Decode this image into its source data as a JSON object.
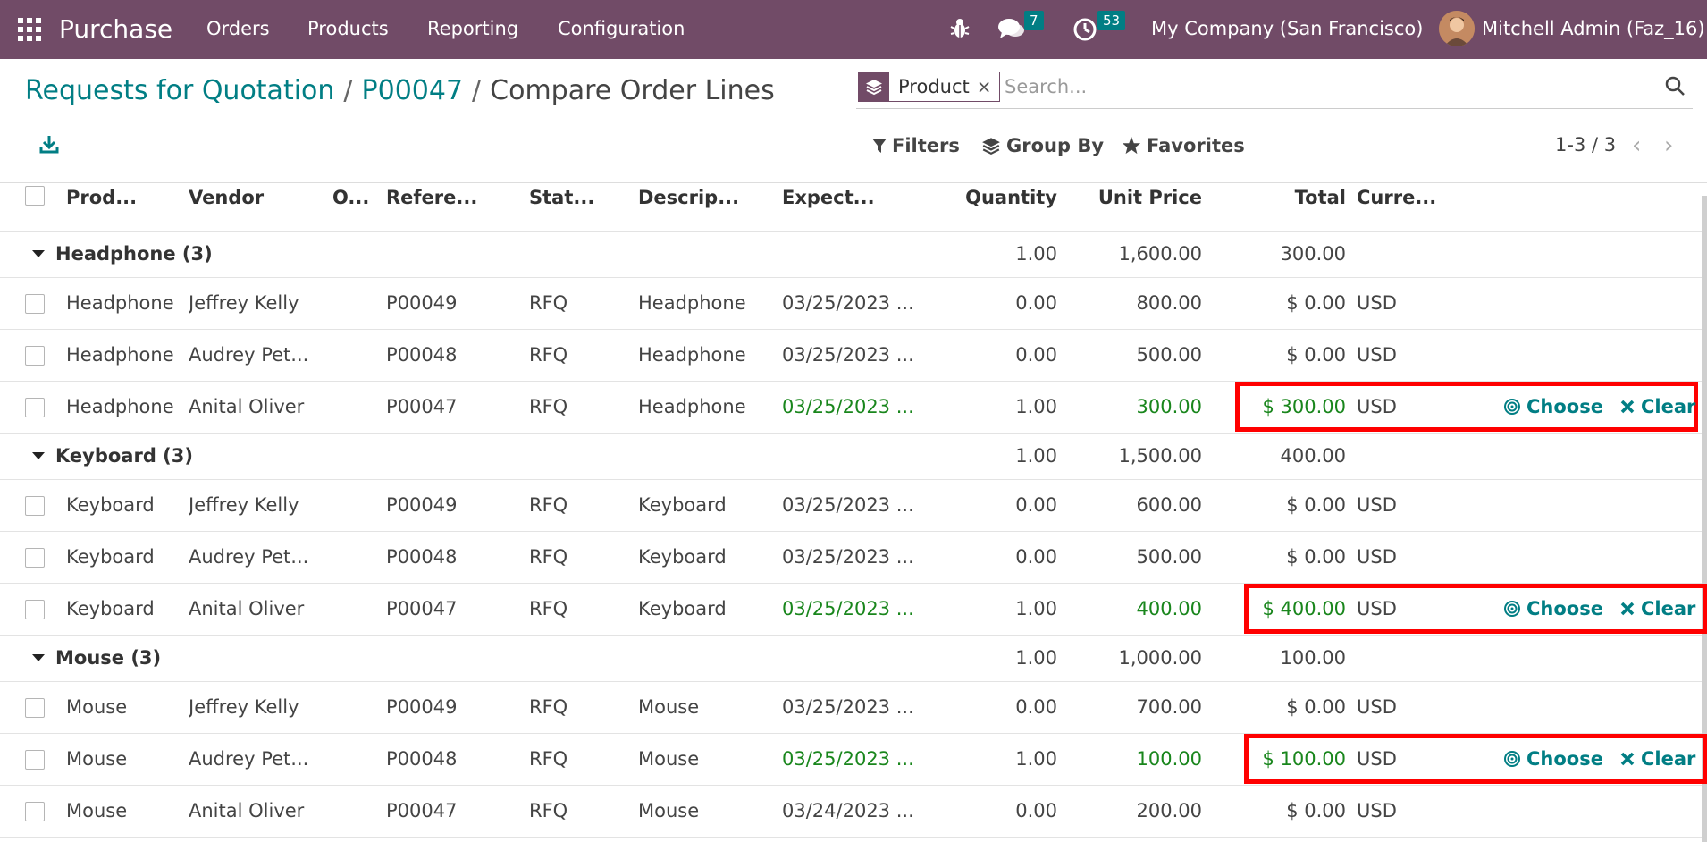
{
  "navbar": {
    "app_name": "Purchase",
    "menu": [
      "Orders",
      "Products",
      "Reporting",
      "Configuration"
    ],
    "messages_count": "7",
    "activities_count": "53",
    "company": "My Company (San Francisco)",
    "user": "Mitchell Admin (Faz_16)"
  },
  "breadcrumb": {
    "items": [
      "Requests for Quotation",
      "P00047",
      "Compare Order Lines"
    ],
    "separator": "/"
  },
  "search": {
    "facet_label": "Product",
    "facet_close": "×",
    "placeholder": "Search..."
  },
  "toolbar": {
    "filters": "Filters",
    "group_by": "Group By",
    "favorites": "Favorites",
    "pager": "1-3 / 3",
    "prev": "‹",
    "next": "›"
  },
  "table": {
    "columns": [
      "Prod...",
      "Vendor",
      "O...",
      "Refere...",
      "Stat...",
      "Descrip...",
      "Expect...",
      "Quantity",
      "Unit Price",
      "Total",
      "Curre..."
    ],
    "action_choose": "Choose",
    "action_clear": "Clear",
    "groups": [
      {
        "label": "Headphone (3)",
        "quantity": "1.00",
        "unit_price": "1,600.00",
        "total": "300.00",
        "rows": [
          {
            "product": "Headphone",
            "vendor": "Jeffrey Kelly",
            "reference": "P00049",
            "status": "RFQ",
            "description": "Headphone",
            "expected": "03/25/2023 ...",
            "quantity": "0.00",
            "unit_price": "800.00",
            "total": "$ 0.00",
            "currency": "USD",
            "best": false
          },
          {
            "product": "Headphone",
            "vendor": "Audrey Pet...",
            "reference": "P00048",
            "status": "RFQ",
            "description": "Headphone",
            "expected": "03/25/2023 ...",
            "quantity": "0.00",
            "unit_price": "500.00",
            "total": "$ 0.00",
            "currency": "USD",
            "best": false
          },
          {
            "product": "Headphone",
            "vendor": "Anital Oliver",
            "reference": "P00047",
            "status": "RFQ",
            "description": "Headphone",
            "expected": "03/25/2023 ...",
            "quantity": "1.00",
            "unit_price": "300.00",
            "total": "$ 300.00",
            "currency": "USD",
            "best": true
          }
        ]
      },
      {
        "label": "Keyboard (3)",
        "quantity": "1.00",
        "unit_price": "1,500.00",
        "total": "400.00",
        "rows": [
          {
            "product": "Keyboard",
            "vendor": "Jeffrey Kelly",
            "reference": "P00049",
            "status": "RFQ",
            "description": "Keyboard",
            "expected": "03/25/2023 ...",
            "quantity": "0.00",
            "unit_price": "600.00",
            "total": "$ 0.00",
            "currency": "USD",
            "best": false
          },
          {
            "product": "Keyboard",
            "vendor": "Audrey Pet...",
            "reference": "P00048",
            "status": "RFQ",
            "description": "Keyboard",
            "expected": "03/25/2023 ...",
            "quantity": "0.00",
            "unit_price": "500.00",
            "total": "$ 0.00",
            "currency": "USD",
            "best": false
          },
          {
            "product": "Keyboard",
            "vendor": "Anital Oliver",
            "reference": "P00047",
            "status": "RFQ",
            "description": "Keyboard",
            "expected": "03/25/2023 ...",
            "quantity": "1.00",
            "unit_price": "400.00",
            "total": "$ 400.00",
            "currency": "USD",
            "best": true
          }
        ]
      },
      {
        "label": "Mouse (3)",
        "quantity": "1.00",
        "unit_price": "1,000.00",
        "total": "100.00",
        "rows": [
          {
            "product": "Mouse",
            "vendor": "Jeffrey Kelly",
            "reference": "P00049",
            "status": "RFQ",
            "description": "Mouse",
            "expected": "03/25/2023 ...",
            "quantity": "0.00",
            "unit_price": "700.00",
            "total": "$ 0.00",
            "currency": "USD",
            "best": false
          },
          {
            "product": "Mouse",
            "vendor": "Audrey Pet...",
            "reference": "P00048",
            "status": "RFQ",
            "description": "Mouse",
            "expected": "03/25/2023 ...",
            "quantity": "1.00",
            "unit_price": "100.00",
            "total": "$ 100.00",
            "currency": "USD",
            "best": true
          },
          {
            "product": "Mouse",
            "vendor": "Anital Oliver",
            "reference": "P00047",
            "status": "RFQ",
            "description": "Mouse",
            "expected": "03/24/2023 ...",
            "quantity": "0.00",
            "unit_price": "200.00",
            "total": "$ 0.00",
            "currency": "USD",
            "best": false
          }
        ]
      }
    ]
  },
  "colors": {
    "navbar": "#714B67",
    "link": "#017e84",
    "best_price": "#19861c",
    "highlight": "#ff0000"
  }
}
